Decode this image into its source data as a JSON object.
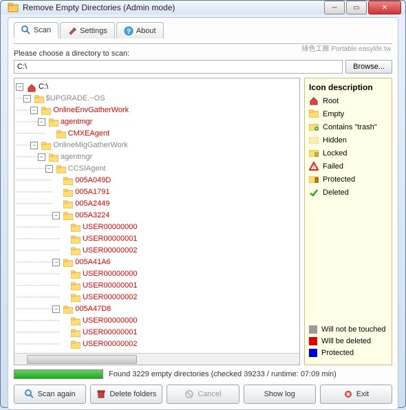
{
  "window": {
    "title": "Remove Empty Directories (Admin mode)"
  },
  "tabs": {
    "scan": "Scan",
    "settings": "Settings",
    "about": "About"
  },
  "dir": {
    "label": "Please choose a directory to scan:",
    "value": "C:\\",
    "browse": "Browse..."
  },
  "watermark": "綠色工廠 Portable.easylife.tw",
  "tree": [
    {
      "depth": 0,
      "toggle": "-",
      "icon": "root",
      "label": "C:\\",
      "cls": "black"
    },
    {
      "depth": 1,
      "toggle": "-",
      "icon": "folder",
      "label": "$UPGRADE.~OS",
      "cls": "gray"
    },
    {
      "depth": 2,
      "toggle": "-",
      "icon": "folder",
      "label": "OnlineEnvGatherWork",
      "cls": "red"
    },
    {
      "depth": 3,
      "toggle": "-",
      "icon": "folder",
      "label": "agentmgr",
      "cls": "red"
    },
    {
      "depth": 4,
      "toggle": "",
      "icon": "folder",
      "label": "CMXEAgent",
      "cls": "red"
    },
    {
      "depth": 2,
      "toggle": "-",
      "icon": "folder",
      "label": "OnlineMigGatherWork",
      "cls": "gray"
    },
    {
      "depth": 3,
      "toggle": "-",
      "icon": "folder",
      "label": "agentmgr",
      "cls": "gray"
    },
    {
      "depth": 4,
      "toggle": "-",
      "icon": "folder",
      "label": "CCSIAgent",
      "cls": "gray"
    },
    {
      "depth": 5,
      "toggle": "",
      "icon": "folder",
      "label": "005A049D",
      "cls": "red"
    },
    {
      "depth": 5,
      "toggle": "",
      "icon": "folder",
      "label": "005A1791",
      "cls": "red"
    },
    {
      "depth": 5,
      "toggle": "",
      "icon": "folder",
      "label": "005A2449",
      "cls": "red"
    },
    {
      "depth": 5,
      "toggle": "-",
      "icon": "folder",
      "label": "005A3224",
      "cls": "red"
    },
    {
      "depth": 6,
      "toggle": "",
      "icon": "folder",
      "label": "USER00000000",
      "cls": "red"
    },
    {
      "depth": 6,
      "toggle": "",
      "icon": "folder",
      "label": "USER00000001",
      "cls": "red"
    },
    {
      "depth": 6,
      "toggle": "",
      "icon": "folder",
      "label": "USER00000002",
      "cls": "red"
    },
    {
      "depth": 5,
      "toggle": "-",
      "icon": "folder",
      "label": "005A41A6",
      "cls": "red"
    },
    {
      "depth": 6,
      "toggle": "",
      "icon": "folder",
      "label": "USER00000000",
      "cls": "red"
    },
    {
      "depth": 6,
      "toggle": "",
      "icon": "folder",
      "label": "USER00000001",
      "cls": "red"
    },
    {
      "depth": 6,
      "toggle": "",
      "icon": "folder",
      "label": "USER00000002",
      "cls": "red"
    },
    {
      "depth": 5,
      "toggle": "-",
      "icon": "folder",
      "label": "005A47D8",
      "cls": "red"
    },
    {
      "depth": 6,
      "toggle": "",
      "icon": "folder",
      "label": "USER00000000",
      "cls": "red"
    },
    {
      "depth": 6,
      "toggle": "",
      "icon": "folder",
      "label": "USER00000001",
      "cls": "red"
    },
    {
      "depth": 6,
      "toggle": "",
      "icon": "folder",
      "label": "USER00000002",
      "cls": "red"
    }
  ],
  "legend": {
    "title": "Icon description",
    "items": [
      {
        "icon": "root",
        "label": "Root"
      },
      {
        "icon": "folder",
        "label": "Empty"
      },
      {
        "icon": "trash",
        "label": "Contains \"trash\""
      },
      {
        "icon": "hidden",
        "label": "Hidden"
      },
      {
        "icon": "locked",
        "label": "Locked"
      },
      {
        "icon": "failed",
        "label": "Failed"
      },
      {
        "icon": "protected",
        "label": "Protected"
      },
      {
        "icon": "deleted",
        "label": "Deleted"
      }
    ],
    "colors": [
      {
        "color": "#999999",
        "label": "Will not be touched"
      },
      {
        "color": "#e00000",
        "label": "Will be deleted"
      },
      {
        "color": "#0000d0",
        "label": "Protected"
      }
    ]
  },
  "status": "Found 3229 empty directories (checked 39233 / runtime: 07:09 min)",
  "buttons": {
    "scan_again": "Scan again",
    "delete_folders": "Delete folders",
    "cancel": "Cancel",
    "show_log": "Show log",
    "exit": "Exit"
  }
}
